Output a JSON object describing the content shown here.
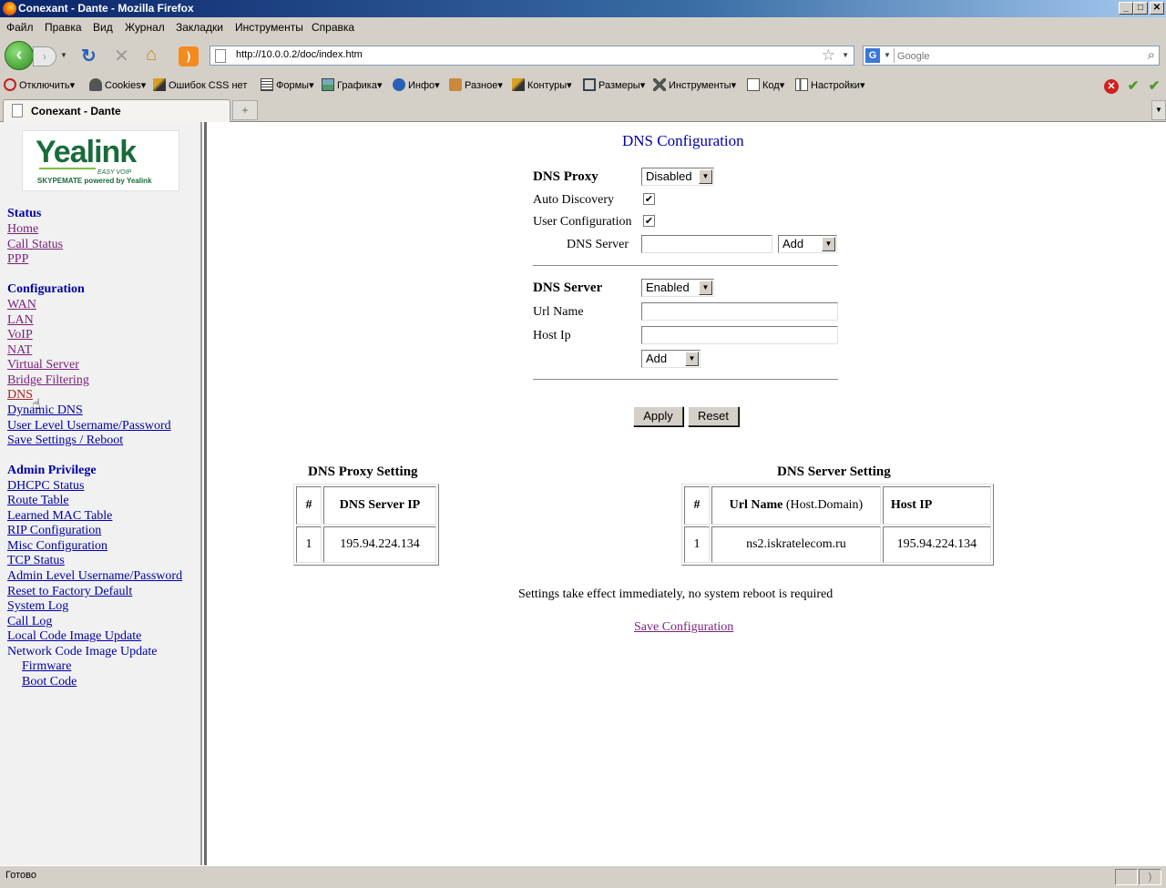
{
  "window": {
    "title": "Conexant - Dante - Mozilla Firefox",
    "buttons": {
      "minimize": "_",
      "maximize": "□",
      "close": "✕"
    }
  },
  "menu": [
    "Файл",
    "Правка",
    "Вид",
    "Журнал",
    "Закладки",
    "Инструменты",
    "Справка"
  ],
  "nav": {
    "url": "http://10.0.0.2/doc/index.htm",
    "search_placeholder": "Google"
  },
  "devbar": {
    "items": [
      "Отключить",
      "Cookies",
      "Ошибок CSS нет",
      "Формы",
      "Графика",
      "Инфо",
      "Разное",
      "Контуры",
      "Размеры",
      "Инструменты",
      "Код",
      "Настройки"
    ]
  },
  "tab": {
    "label": "Conexant - Dante"
  },
  "sidebar": {
    "logo": {
      "brand": "Yealink",
      "tagline": "EASY VOIP",
      "subline": "SKYPEMATE powered by Yealink"
    },
    "status_heading": "Status",
    "status_links": [
      "Home",
      "Call Status",
      "PPP"
    ],
    "config_heading": "Configuration",
    "config_links": [
      "WAN",
      "LAN",
      "VoIP",
      "NAT",
      "Virtual Server",
      "Bridge Filtering",
      "DNS",
      "Dynamic DNS",
      "User Level Username/Password",
      "Save Settings / Reboot"
    ],
    "admin_heading": "Admin Privilege",
    "admin_links": [
      "DHCPC Status",
      "Route Table",
      "Learned MAC Table",
      "RIP Configuration",
      "Misc Configuration",
      "TCP Status",
      "Admin Level Username/Password",
      "Reset to Factory Default",
      "System Log",
      "Call Log",
      "Local Code Image Update"
    ],
    "network_update": "Network Code Image Update",
    "network_sub": [
      "Firmware",
      "Boot Code"
    ]
  },
  "page": {
    "title": "DNS Configuration",
    "dns_proxy_label": "DNS Proxy",
    "dns_proxy_value": "Disabled",
    "auto_discovery_label": "Auto Discovery",
    "auto_discovery_checked": true,
    "user_config_label": "User Configuration",
    "user_config_checked": true,
    "dns_server_field_label": "DNS Server",
    "dns_server_field_value": "",
    "dns_server_action": "Add",
    "dns_server_label": "DNS Server",
    "dns_server_value": "Enabled",
    "url_name_label": "Url Name",
    "url_name_value": "",
    "host_ip_label": "Host Ip",
    "host_ip_value": "",
    "host_action": "Add",
    "apply_label": "Apply",
    "reset_label": "Reset",
    "proxy_table": {
      "caption": "DNS Proxy Setting",
      "headers": [
        "#",
        "DNS Server IP"
      ],
      "rows": [
        [
          "1",
          "195.94.224.134"
        ]
      ]
    },
    "server_table": {
      "caption": "DNS Server Setting",
      "headers": [
        "#",
        "Url Name",
        "(Host.Domain)",
        "Host IP"
      ],
      "rows": [
        [
          "1",
          "ns2.iskratelecom.ru",
          "195.94.224.134"
        ]
      ]
    },
    "notice": "Settings take effect immediately, no system reboot is required",
    "save_link": "Save Configuration"
  },
  "status": {
    "text": "Готово"
  }
}
